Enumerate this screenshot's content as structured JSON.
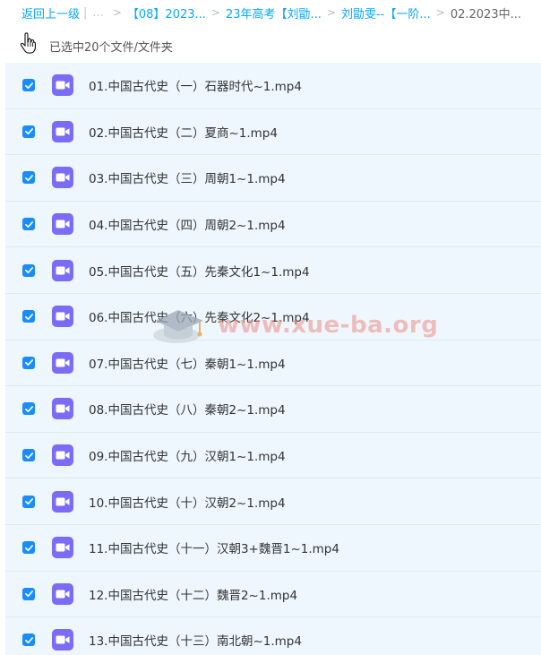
{
  "breadcrumb": {
    "back_label": "返回上一级",
    "divider": "|",
    "ellipsis": "...",
    "arrow": ">",
    "items": [
      "【08】2023...",
      "23年高考【刘勖...",
      "刘勖雯--【一阶...",
      "02.2023中..."
    ]
  },
  "selection": {
    "text": "已选中20个文件/文件夹"
  },
  "files": [
    {
      "name": "01.中国古代史（一）石器时代~1.mp4",
      "checked": true
    },
    {
      "name": "02.中国古代史（二）夏商~1.mp4",
      "checked": true
    },
    {
      "name": "03.中国古代史（三）周朝1~1.mp4",
      "checked": true
    },
    {
      "name": "04.中国古代史（四）周朝2~1.mp4",
      "checked": true
    },
    {
      "name": "05.中国古代史（五）先秦文化1~1.mp4",
      "checked": true
    },
    {
      "name": "06.中国古代史（六）先秦文化2~1.mp4",
      "checked": true
    },
    {
      "name": "07.中国古代史（七）秦朝1~1.mp4",
      "checked": true
    },
    {
      "name": "08.中国古代史（八）秦朝2~1.mp4",
      "checked": true
    },
    {
      "name": "09.中国古代史（九）汉朝1~1.mp4",
      "checked": true
    },
    {
      "name": "10.中国古代史（十）汉朝2~1.mp4",
      "checked": true
    },
    {
      "name": "11.中国古代史（十一）汉朝3+魏晋1~1.mp4",
      "checked": true
    },
    {
      "name": "12.中国古代史（十二）魏晋2~1.mp4",
      "checked": true
    },
    {
      "name": "13.中国古代史（十三）南北朝~1.mp4",
      "checked": true
    }
  ],
  "watermark": {
    "text": "www.xue-ba.org"
  },
  "colors": {
    "accent": "#06a7ff",
    "checkbox": "#1a8cff",
    "video_icon": "#7b6cf6",
    "list_bg": "#eef7fe"
  }
}
